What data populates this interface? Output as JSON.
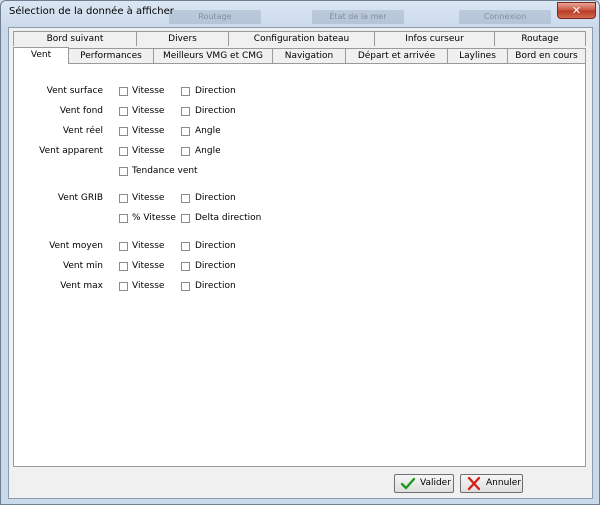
{
  "window": {
    "title": "Sélection de la donnée à afficher",
    "close_glyph": "✕"
  },
  "background_tabs": [
    "Routage",
    "État de la mer",
    "Connexion"
  ],
  "tabs_row1": [
    "Bord suivant",
    "Divers",
    "Configuration bateau",
    "Infos curseur",
    "Routage"
  ],
  "tabs_row2": [
    "Vent",
    "Performances",
    "Meilleurs VMG et CMG",
    "Navigation",
    "Départ et arrivée",
    "Laylines",
    "Bord en cours"
  ],
  "active_tab": "Vent",
  "rows": [
    {
      "label": "Vent surface",
      "opts": [
        "Vitesse",
        "Direction"
      ]
    },
    {
      "label": "Vent fond",
      "opts": [
        "Vitesse",
        "Direction"
      ]
    },
    {
      "label": "Vent réel",
      "opts": [
        "Vitesse",
        "Angle"
      ]
    },
    {
      "label": "Vent apparent",
      "opts": [
        "Vitesse",
        "Angle"
      ]
    },
    {
      "label": "",
      "opts": [
        "Tendance vent"
      ]
    },
    {
      "label": "Vent GRIB",
      "opts": [
        "Vitesse",
        "Direction"
      ]
    },
    {
      "label": "",
      "opts": [
        "% Vitesse",
        "Delta direction"
      ]
    },
    {
      "label": "Vent moyen",
      "opts": [
        "Vitesse",
        "Direction"
      ]
    },
    {
      "label": "Vent min",
      "opts": [
        "Vitesse",
        "Direction"
      ]
    },
    {
      "label": "Vent max",
      "opts": [
        "Vitesse",
        "Direction"
      ]
    }
  ],
  "buttons": {
    "ok": "Valider",
    "cancel": "Annuler"
  },
  "colors": {
    "ok_icon": "#1f9a1f",
    "cancel_icon": "#d4201c",
    "close": "#c7513c"
  },
  "icons": {
    "ok": "checkmark-icon",
    "cancel": "cross-icon"
  }
}
